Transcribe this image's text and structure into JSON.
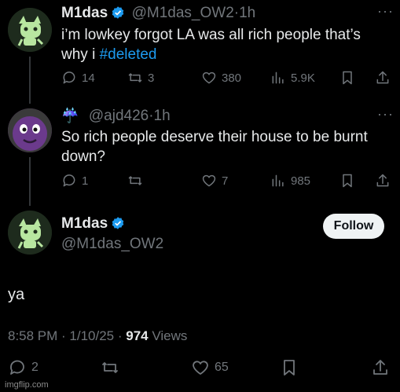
{
  "tweets": [
    {
      "name": "M1das",
      "handle": "@M1das_OW2",
      "time_sep": "·",
      "time": "1h",
      "text_prefix": "i’m lowkey forgot LA was all rich  people that’s",
      "text_line2": "why i ",
      "hashtag": "#deleted",
      "replies": "14",
      "reposts": "3",
      "likes": "380",
      "views": "5.9K"
    },
    {
      "emoji": "☔",
      "handle": "@ajd426",
      "time_sep": "·",
      "time": "1h",
      "text_line1": "So rich people deserve their house to be burnt",
      "text_line2": "down?",
      "replies": "1",
      "reposts": "",
      "likes": "7",
      "views": "985"
    }
  ],
  "main_tweet": {
    "name": "M1das",
    "handle": "@M1das_OW2",
    "follow_label": "Follow",
    "text": "ya",
    "timestamp": "8:58 PM · 1/10/25 · ",
    "views_count": "974",
    "views_label": " Views",
    "replies": "2",
    "reposts": "",
    "likes": "65"
  },
  "watermark": "imgflip.com",
  "colors": {
    "background": "#000000",
    "text": "#e7e9ea",
    "muted": "#71767b",
    "accent": "#1d9bf0",
    "follow_bg": "#eff3f4"
  }
}
